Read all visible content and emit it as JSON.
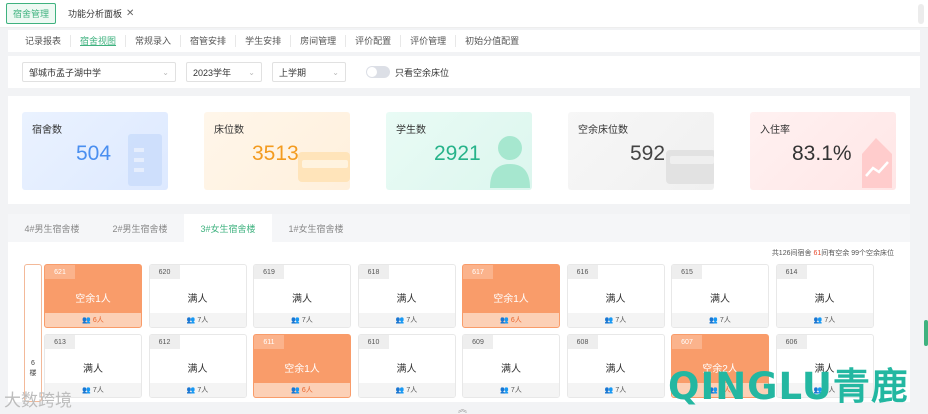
{
  "topbar": {
    "module": "宿舍管理",
    "open_tab": "功能分析面板"
  },
  "nav": {
    "tabs": [
      {
        "label": "记录报表",
        "active": false
      },
      {
        "label": "宿舍视图",
        "active": true
      },
      {
        "label": "常规录入",
        "active": false
      },
      {
        "label": "宿管安排",
        "active": false
      },
      {
        "label": "学生安排",
        "active": false
      },
      {
        "label": "房间管理",
        "active": false
      },
      {
        "label": "评价配置",
        "active": false
      },
      {
        "label": "评价管理",
        "active": false
      },
      {
        "label": "初始分值配置",
        "active": false
      }
    ]
  },
  "filters": {
    "school": "邹城市孟子湖中学",
    "year": "2023学年",
    "term": "上学期",
    "toggle_label": "只看空余床位"
  },
  "stats": {
    "dorms": {
      "label": "宿舍数",
      "value": "504",
      "color": "#4a8ff0"
    },
    "beds": {
      "label": "床位数",
      "value": "3513",
      "color": "#f39b1f"
    },
    "students": {
      "label": "学生数",
      "value": "2921",
      "color": "#27b38a"
    },
    "free": {
      "label": "空余床位数",
      "value": "592",
      "color": "#444444"
    },
    "rate": {
      "label": "入住率",
      "value": "83.1%",
      "color": "#333333"
    }
  },
  "building_tabs": [
    {
      "label": "4#男生宿舍楼",
      "active": false
    },
    {
      "label": "2#男生宿舍楼",
      "active": false
    },
    {
      "label": "3#女生宿舍楼",
      "active": true
    },
    {
      "label": "1#女生宿舍楼",
      "active": false
    }
  ],
  "summary": {
    "prefix": "共126间宿舍",
    "count": "61",
    "mid": "间有空余",
    "suffix": "99个空余床位"
  },
  "floor": {
    "line1": "6",
    "line2": "楼"
  },
  "rooms_row1": [
    {
      "num": "621",
      "status": "空余1人",
      "count": "6人",
      "vacant": true
    },
    {
      "num": "620",
      "status": "满人",
      "count": "7人",
      "vacant": false
    },
    {
      "num": "619",
      "status": "满人",
      "count": "7人",
      "vacant": false
    },
    {
      "num": "618",
      "status": "满人",
      "count": "7人",
      "vacant": false
    },
    {
      "num": "617",
      "status": "空余1人",
      "count": "6人",
      "vacant": true
    },
    {
      "num": "616",
      "status": "满人",
      "count": "7人",
      "vacant": false
    },
    {
      "num": "615",
      "status": "满人",
      "count": "7人",
      "vacant": false
    },
    {
      "num": "614",
      "status": "满人",
      "count": "7人",
      "vacant": false
    }
  ],
  "rooms_row2": [
    {
      "num": "613",
      "status": "满人",
      "count": "7人",
      "vacant": false
    },
    {
      "num": "612",
      "status": "满人",
      "count": "7人",
      "vacant": false
    },
    {
      "num": "611",
      "status": "空余1人",
      "count": "6人",
      "vacant": true
    },
    {
      "num": "610",
      "status": "满人",
      "count": "7人",
      "vacant": false
    },
    {
      "num": "609",
      "status": "满人",
      "count": "7人",
      "vacant": false
    },
    {
      "num": "608",
      "status": "满人",
      "count": "7人",
      "vacant": false
    },
    {
      "num": "607",
      "status": "空余2人",
      "count": "5人",
      "vacant": true
    },
    {
      "num": "606",
      "status": "满人",
      "count": "7人",
      "vacant": false
    }
  ],
  "watermarks": {
    "left": "大数跨境",
    "right": "QINGLU青鹿"
  }
}
